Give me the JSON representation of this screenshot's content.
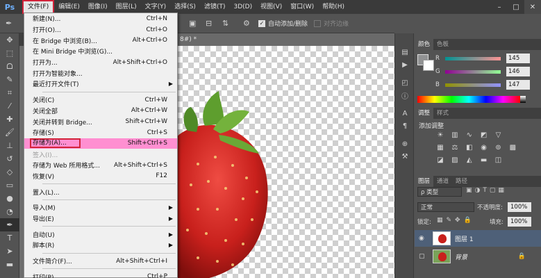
{
  "app": {
    "logo": "Ps",
    "colors": {
      "menubar": "#3a3a3a",
      "highlight": "#ff8fd1",
      "annotation": "#d3243b",
      "selected_layer": "#4e6078"
    }
  },
  "menubar": {
    "items": [
      "文件(F)",
      "编辑(E)",
      "图像(I)",
      "图层(L)",
      "文字(Y)",
      "选择(S)",
      "滤镜(T)",
      "3D(D)",
      "视图(V)",
      "窗口(W)",
      "帮助(H)"
    ],
    "active": "文件(F)"
  },
  "options_bar": {
    "auto_add_label": "自动添加/删除",
    "auto_add_checked": true,
    "align_edges_label": "对齐边缘",
    "align_edges_checked": false
  },
  "document": {
    "tab_label": "8#) *"
  },
  "file_menu": {
    "groups": [
      [
        {
          "label": "新建(N)...",
          "shortcut": "Ctrl+N"
        },
        {
          "label": "打开(O)...",
          "shortcut": "Ctrl+O"
        },
        {
          "label": "在 Bridge 中浏览(B)...",
          "shortcut": "Alt+Ctrl+O"
        },
        {
          "label": "在 Mini Bridge 中浏览(G)...",
          "shortcut": ""
        },
        {
          "label": "打开为...",
          "shortcut": "Alt+Shift+Ctrl+O"
        },
        {
          "label": "打开为智能对象...",
          "shortcut": ""
        },
        {
          "label": "最近打开文件(T)",
          "shortcut": "",
          "submenu": true
        }
      ],
      [
        {
          "label": "关闭(C)",
          "shortcut": "Ctrl+W"
        },
        {
          "label": "关闭全部",
          "shortcut": "Alt+Ctrl+W"
        },
        {
          "label": "关闭并转到 Bridge...",
          "shortcut": "Shift+Ctrl+W"
        },
        {
          "label": "存储(S)",
          "shortcut": "Ctrl+S"
        },
        {
          "label": "存储为(A)...",
          "shortcut": "Shift+Ctrl+S",
          "highlighted": true
        },
        {
          "label": "签入(I)...",
          "shortcut": "",
          "disabled": true
        },
        {
          "label": "存储为 Web 所用格式...",
          "shortcut": "Alt+Shift+Ctrl+S"
        },
        {
          "label": "恢复(V)",
          "shortcut": "F12"
        }
      ],
      [
        {
          "label": "置入(L)...",
          "shortcut": ""
        }
      ],
      [
        {
          "label": "导入(M)",
          "shortcut": "",
          "submenu": true
        },
        {
          "label": "导出(E)",
          "shortcut": "",
          "submenu": true
        }
      ],
      [
        {
          "label": "自动(U)",
          "shortcut": "",
          "submenu": true
        },
        {
          "label": "脚本(R)",
          "shortcut": "",
          "submenu": true
        }
      ],
      [
        {
          "label": "文件简介(F)...",
          "shortcut": "Alt+Shift+Ctrl+I"
        }
      ],
      [
        {
          "label": "打印(P)...",
          "shortcut": "Ctrl+P"
        }
      ]
    ]
  },
  "color_panel": {
    "tabs": [
      "颜色",
      "色板"
    ],
    "channels": [
      {
        "name": "R",
        "value": "145",
        "gradient": "linear-gradient(90deg,#009393,#ff9393)"
      },
      {
        "name": "G",
        "value": "146",
        "gradient": "linear-gradient(90deg,#910093,#91ff93)"
      },
      {
        "name": "B",
        "value": "147",
        "gradient": "linear-gradient(90deg,#919200,#9192ff)"
      }
    ]
  },
  "adjustments_panel": {
    "tabs": [
      "调整",
      "样式"
    ],
    "title": "添加调整"
  },
  "layers_panel": {
    "tabs": [
      "图层",
      "通道",
      "路径"
    ],
    "filter_label": "ρ 类型",
    "blend_mode": "正常",
    "opacity_label": "不透明度:",
    "opacity_value": "100%",
    "lock_label": "锁定:",
    "fill_label": "填充:",
    "fill_value": "100%",
    "layers": [
      {
        "name": "图层 1",
        "selected": true,
        "visible": true
      },
      {
        "name": "背景",
        "selected": false,
        "visible": false,
        "locked": true
      }
    ]
  }
}
